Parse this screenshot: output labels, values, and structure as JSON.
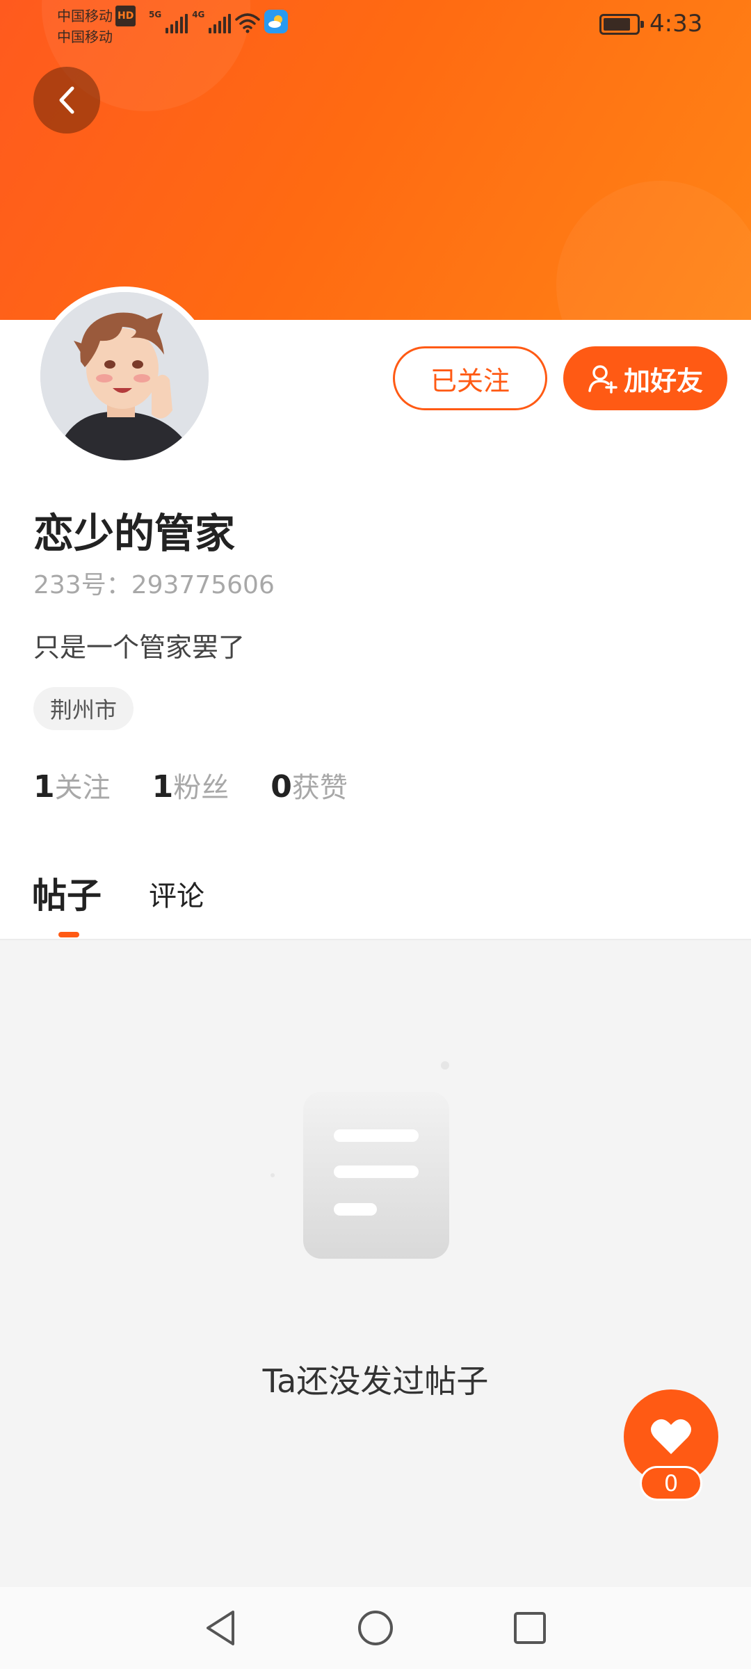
{
  "status_bar": {
    "carrier_1": "中国移动",
    "carrier_hd": "HD",
    "carrier_2": "中国移动",
    "net_1": "5G",
    "net_2": "4G",
    "time": "4:33"
  },
  "profile": {
    "username": "恋少的管家",
    "uid_text": "233号：293775606",
    "bio": "只是一个管家罢了",
    "location": "荆州市",
    "follow_button": "已关注",
    "add_friend_button": "加好友"
  },
  "stats": [
    {
      "num": "1",
      "label": "关注"
    },
    {
      "num": "1",
      "label": "粉丝"
    },
    {
      "num": "0",
      "label": "获赞"
    }
  ],
  "tabs": {
    "posts": "帖子",
    "comments": "评论",
    "active": "posts"
  },
  "empty_state": {
    "text": "Ta还没发过帖子"
  },
  "like_fab": {
    "count": "0"
  },
  "colors": {
    "accent": "#ff5a14",
    "header_start": "#ff5a1e",
    "header_end": "#ff8416"
  }
}
